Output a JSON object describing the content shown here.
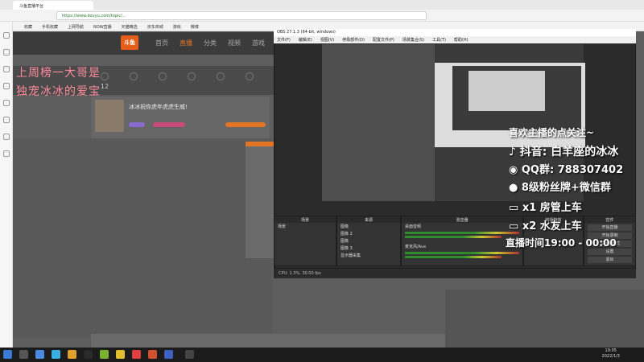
{
  "browser": {
    "tab_title": "斗鱼直播平台",
    "url": "https://www.douyu.com/topic/...",
    "bookmarks": [
      "收藏",
      "手机收藏",
      "上网导航",
      "NOW直播",
      "天猫精选",
      "京东商城",
      "游戏",
      "微博",
      "..."
    ]
  },
  "douyu": {
    "logo": "斗鱼",
    "nav": [
      "首页",
      "直播",
      "分类",
      "视频",
      "游戏"
    ],
    "categories": [
      "",
      "",
      "",
      "",
      "",
      "",
      ""
    ],
    "anchor_title": "冰冰祝你虎年虎虎生威!",
    "room_num": "12"
  },
  "stream_text": {
    "red_line_1": "上周榜一大哥是",
    "red_line_2": "独宠冰冰的爱宝"
  },
  "obs": {
    "title": "OBS 27.1.3 (64-bit, windows)",
    "menu": [
      "文件(F)",
      "编辑(E)",
      "视图(V)",
      "停靠部件(D)",
      "配置文件(P)",
      "场景集合(S)",
      "工具(T)",
      "帮助(H)"
    ],
    "panel_scenes": "场景",
    "panel_sources": "来源",
    "panel_mixer": "混音器",
    "panel_transitions": "转场特效",
    "panel_controls": "控件",
    "scene_name": "场景",
    "sources": [
      "图像",
      "图像 2",
      "图像",
      "图像 3",
      "显示器采集"
    ],
    "mixer_tracks": [
      "桌面音频",
      "麦克风/Aux"
    ],
    "controls": [
      "开始直播",
      "开始录制",
      "工作室模式",
      "设置",
      "退出"
    ],
    "status": "CPU: 1.3%, 30.00 fps"
  },
  "overlay": {
    "line1": "喜欢主播的点关注~",
    "line2": "抖音: 白羊座的冰冰",
    "line3": "QQ群: 788307402",
    "line4": "8级粉丝牌+微信群",
    "line5": "x1 房管上车",
    "line6": "x2 水友上车",
    "line7": "直播时间19:00 - 00:00"
  },
  "taskbar": {
    "time": "19:05",
    "date": "2022/1/3"
  }
}
